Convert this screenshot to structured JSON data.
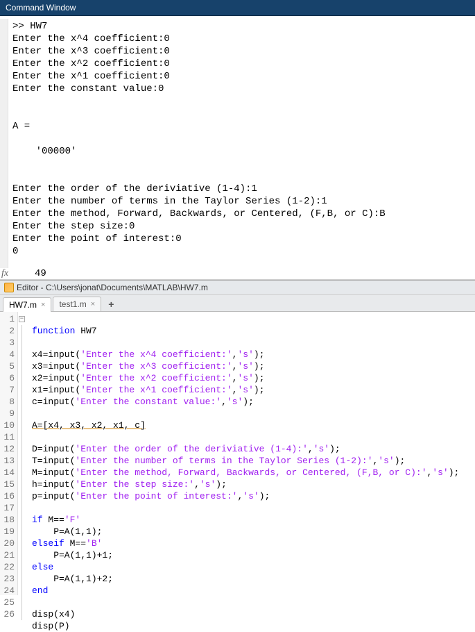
{
  "command_window": {
    "title": "Command Window",
    "output": ">> HW7\nEnter the x^4 coefficient:0\nEnter the x^3 coefficient:0\nEnter the x^2 coefficient:0\nEnter the x^1 coefficient:0\nEnter the constant value:0\n\n\nA =\n\n    '00000'\n\n\nEnter the order of the deriviative (1-4):1\nEnter the number of terms in the Taylor Series (1-2):1\nEnter the method, Forward, Backwards, or Centered, (F,B, or C):B\nEnter the step size:0\nEnter the point of interest:0\n0",
    "fx_label": "fx",
    "fx_value": "49"
  },
  "editor": {
    "title": "Editor - C:\\Users\\jonat\\Documents\\MATLAB\\HW7.m",
    "tabs": [
      {
        "label": "HW7.m",
        "active": true
      },
      {
        "label": "test1.m",
        "active": false
      }
    ],
    "add_tab": "+",
    "lines": {
      "l1": {
        "kw": "function",
        "rest": " HW7"
      },
      "l3a": "x4=input(",
      "l3s": "'Enter the x^4 coefficient:'",
      "l3b": ",",
      "l3s2": "'s'",
      "l3c": ");",
      "l4a": "x3=input(",
      "l4s": "'Enter the x^3 coefficient:'",
      "l4b": ",",
      "l4s2": "'s'",
      "l4c": ");",
      "l5a": "x2=input(",
      "l5s": "'Enter the x^2 coefficient:'",
      "l5b": ",",
      "l5s2": "'s'",
      "l5c": ");",
      "l6a": "x1=input(",
      "l6s": "'Enter the x^1 coefficient:'",
      "l6b": ",",
      "l6s2": "'s'",
      "l6c": ");",
      "l7a": "c=input(",
      "l7s": "'Enter the constant value:'",
      "l7b": ",",
      "l7s2": "'s'",
      "l7c": ");",
      "l9": "A=[x4, x3, x2, x1, c]",
      "l11a": "D=input(",
      "l11s": "'Enter the order of the deriviative (1-4):'",
      "l11b": ",",
      "l11s2": "'s'",
      "l11c": ");",
      "l12a": "T=input(",
      "l12s": "'Enter the number of terms in the Taylor Series (1-2):'",
      "l12b": ",",
      "l12s2": "'s'",
      "l12c": ");",
      "l13a": "M=input(",
      "l13s": "'Enter the method, Forward, Backwards, or Centered, (F,B, or C):'",
      "l13b": ",",
      "l13s2": "'s'",
      "l13c": ");",
      "l14a": "h=input(",
      "l14s": "'Enter the step size:'",
      "l14b": ",",
      "l14s2": "'s'",
      "l14c": ");",
      "l15a": "p=input(",
      "l15s": "'Enter the point of interest:'",
      "l15b": ",",
      "l15s2": "'s'",
      "l15c": ");",
      "l17kw": "if",
      "l17rest": " M==",
      "l17s": "'F'",
      "l18": "    P=A(1,1);",
      "l19kw": "elseif",
      "l19rest": " M==",
      "l19s": "'B'",
      "l20": "    P=A(1,1)+1;",
      "l21kw": "else",
      "l22": "    P=A(1,1)+2;",
      "l23kw": "end",
      "l25": "disp(x4)",
      "l26": "disp(P)"
    },
    "linecount": 26
  }
}
